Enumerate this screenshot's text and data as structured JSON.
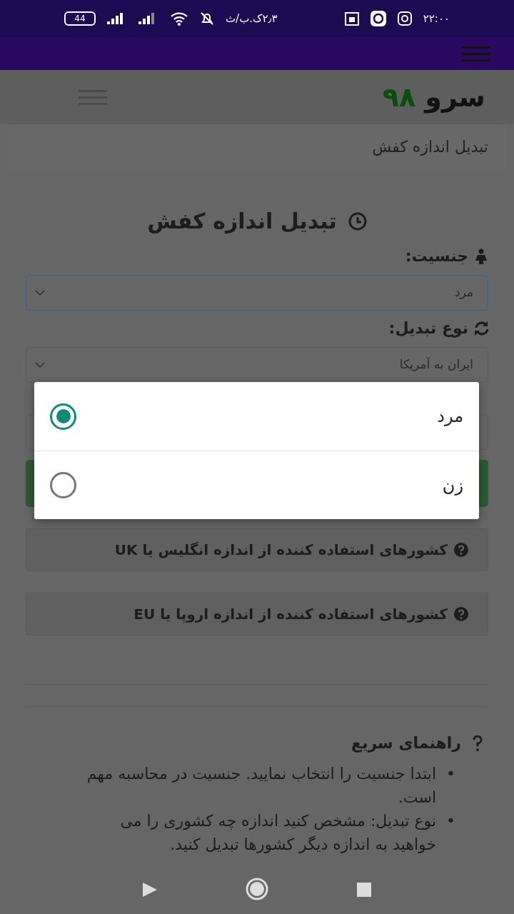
{
  "status_bar": {
    "time": "۲۲:۰۰",
    "data_speed": "۲٫۳ک.ب/ث",
    "battery": "44"
  },
  "site_header": {
    "logo_word": "سرو",
    "logo_number": "۹۸"
  },
  "breadcrumb": "تبدیل اندازه کفش",
  "form": {
    "title": "تبدیل اندازه کفش",
    "fields": [
      {
        "kind": "person",
        "label": "جنسیت:",
        "value": "مرد",
        "focused": true
      },
      {
        "kind": "refresh",
        "label": "نوع تبدیل:",
        "value": "ایران به آمریکا",
        "focused": false
      }
    ]
  },
  "info_panels": [
    "کشورهای استفاده کننده از اندازه انگلیس یا UK",
    "کشورهای استفاده کننده از اندازه اروپا یا EU"
  ],
  "guide": {
    "title": "راهنمای سریع",
    "bullet": "•",
    "items": [
      "ابتدا جنسیت را انتخاب نمایید. جنسیت در محاسبه مهم است.",
      "نوع تبدیل: مشخص کنید اندازه چه کشوری را می خواهید به اندازه دیگر کشورها تبدیل کنید."
    ]
  },
  "dialog": {
    "options": [
      {
        "label": "مرد",
        "selected": true
      },
      {
        "label": "زن",
        "selected": false
      }
    ]
  }
}
